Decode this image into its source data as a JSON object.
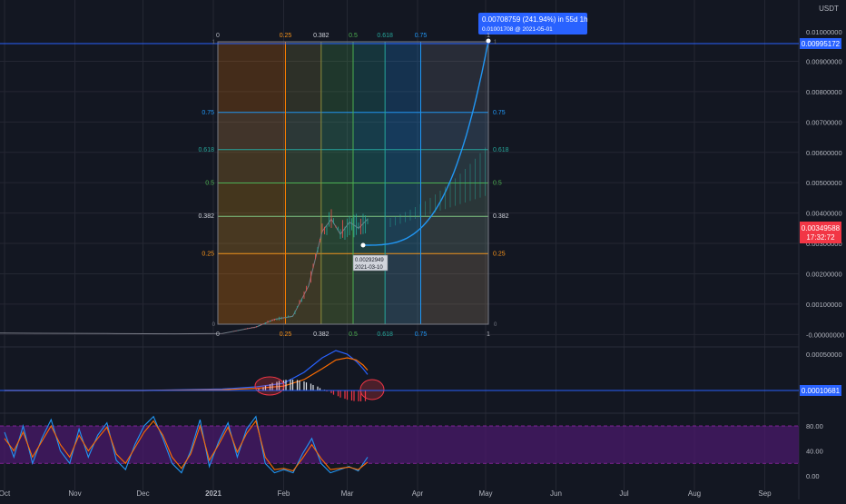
{
  "currency_label": "USDT",
  "colors": {
    "background": "#131722",
    "grid": "#242733",
    "text": "#b2b5be",
    "blue": "#2962ff",
    "price_red": "#f23645",
    "fib_025": "#f7931a",
    "fib_0382": "#81c784",
    "fib_05": "#4caf50",
    "fib_0618": "#26a69a",
    "fib_075": "#2196f3",
    "fib_1": "#787b86",
    "rsi_band": "#4a1a6b",
    "macd_line": "#2962ff",
    "signal_line": "#ff6d00",
    "stoch_k": "#2196f3",
    "stoch_d": "#ff6d00"
  },
  "tooltip": {
    "headline": "0.00708759 (241.94%) in 55d 1h",
    "subline": "0.01001708 @ 2021-05-01"
  },
  "small_label": {
    "line1": "0.00292949",
    "line2": "2021-03-10"
  },
  "price_tags": {
    "target": "0.00995172",
    "current": "0.00349588",
    "countdown": "17:32:72",
    "macd": "0.00010681"
  },
  "chart_data": [
    {
      "type": "line",
      "title": "",
      "x_ticks": [
        "Oct",
        "Nov",
        "Dec",
        "2021",
        "Feb",
        "Mar",
        "Apr",
        "May",
        "Jun",
        "Jul",
        "Aug",
        "Sep"
      ],
      "y_ticks": [
        "0.00900000",
        "0.00800000",
        "0.00700000",
        "0.00600000",
        "0.00500000",
        "0.00400000",
        "0.00300000",
        "0.00200000",
        "0.00100000",
        "-0.00000000"
      ],
      "ylim": [
        -0.0002,
        0.0106
      ],
      "top_tick_partial": "0.01000000",
      "grid": true,
      "series": [
        {
          "values_note": "price (approx)",
          "points": [
            [
              "2020-09-20",
              5e-05
            ],
            [
              "2020-10-15",
              4e-05
            ],
            [
              "2020-11-15",
              3e-05
            ],
            [
              "2020-12-15",
              2e-05
            ],
            [
              "2021-01-05",
              3e-05
            ],
            [
              "2021-01-20",
              0.00025
            ],
            [
              "2021-01-28",
              0.0005
            ],
            [
              "2021-02-05",
              0.0006
            ],
            [
              "2021-02-12",
              0.0016
            ],
            [
              "2021-02-18",
              0.0034
            ],
            [
              "2021-02-22",
              0.0038
            ],
            [
              "2021-02-26",
              0.0033
            ],
            [
              "2021-03-02",
              0.0037
            ],
            [
              "2021-03-06",
              0.0035
            ],
            [
              "2021-03-10",
              0.0038
            ]
          ]
        }
      ],
      "projection": {
        "from": [
          "2021-03-10",
          0.00292949
        ],
        "to": [
          "2021-05-01",
          0.01001708
        ]
      },
      "fib_levels": {
        "vertical": [
          "0",
          "0.25",
          "0.382",
          "0.5",
          "0.618",
          "0.75",
          "1"
        ],
        "horizontal": [
          "0",
          "0.25",
          "0.382",
          "0.5",
          "0.618",
          "0.75",
          "1"
        ]
      }
    },
    {
      "type": "line",
      "title": "",
      "y_ticks": [
        "0.00050000"
      ],
      "series": [
        {
          "name": "",
          "values": [
            0.0,
            0.0,
            0.0,
            2e-05,
            5e-05,
            0.0001,
            0.00025,
            0.00045,
            0.00055,
            0.0005,
            0.0004,
            0.0003,
            0.00022
          ]
        },
        {
          "name": "",
          "values": [
            0.0,
            0.0,
            0.0,
            1e-05,
            3e-05,
            6e-05,
            0.00015,
            0.0003,
            0.00042,
            0.00045,
            0.00042,
            0.00035,
            0.00028
          ]
        }
      ]
    },
    {
      "type": "line",
      "title": "",
      "y_ticks": [
        "80.00",
        "40.00",
        "0.00"
      ],
      "band": [
        20,
        80
      ],
      "ylim": [
        -5,
        100
      ],
      "series": [
        {
          "name": "",
          "values": [
            70,
            30,
            80,
            20,
            60,
            90,
            40,
            20,
            75,
            30,
            65,
            85,
            25,
            10,
            50,
            80,
            95,
            60,
            20,
            5,
            40,
            90,
            15,
            55,
            85,
            30,
            75,
            95,
            20,
            5,
            10,
            5,
            35,
            60,
            20,
            5,
            10,
            15,
            8,
            30
          ]
        },
        {
          "name": "",
          "values": [
            60,
            40,
            70,
            30,
            55,
            80,
            50,
            30,
            65,
            40,
            60,
            78,
            35,
            20,
            45,
            70,
            88,
            65,
            30,
            12,
            35,
            80,
            25,
            50,
            78,
            38,
            68,
            88,
            30,
            10,
            12,
            8,
            28,
            50,
            28,
            10,
            12,
            14,
            10,
            22
          ]
        }
      ]
    }
  ]
}
